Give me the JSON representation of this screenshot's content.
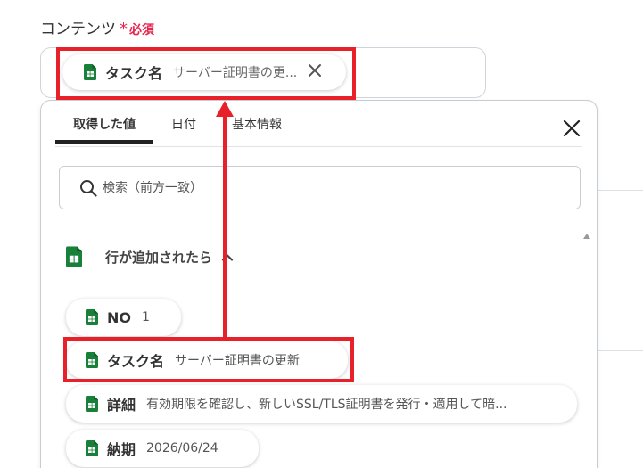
{
  "field": {
    "label": "コンテンツ",
    "required_mark": "*",
    "required_text": "必須"
  },
  "input_token": {
    "label": "タスク名",
    "value": "サーバー証明書の更...",
    "icon": "google-sheets-icon",
    "remove_icon": "close-icon"
  },
  "panel": {
    "tabs": [
      {
        "label": "取得した値",
        "active": true
      },
      {
        "label": "日付",
        "active": false
      },
      {
        "label": "基本情報",
        "active": false
      }
    ],
    "close_icon": "close-icon",
    "search": {
      "placeholder": "検索（前方一致）",
      "value": ""
    },
    "section": {
      "label": "行が追加されたら",
      "icon": "google-sheets-icon",
      "expanded": true
    },
    "items": [
      {
        "label": "NO",
        "value": "1"
      },
      {
        "label": "タスク名",
        "value": "サーバー証明書の更新"
      },
      {
        "label": "詳細",
        "value": "有効期限を確認し、新しいSSL/TLS証明書を発行・適用して暗..."
      },
      {
        "label": "納期",
        "value": "2026/06/24"
      }
    ]
  },
  "colors": {
    "highlight": "#e8202a",
    "required": "#e5274f",
    "sheets_green": "#188038",
    "border": "#c7ccd2"
  }
}
